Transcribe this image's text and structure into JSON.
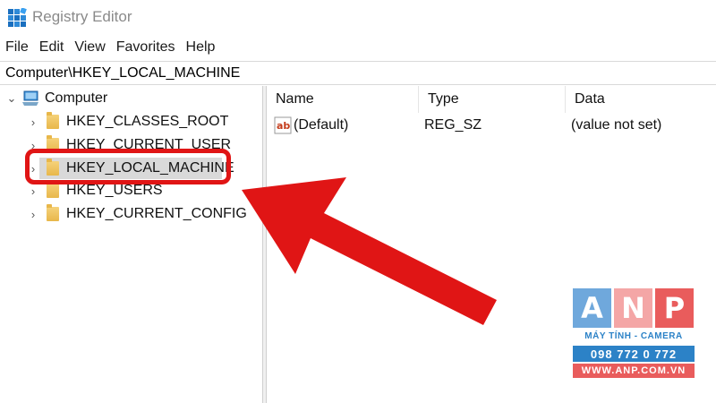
{
  "window": {
    "title": "Registry Editor",
    "icon": "registry-icon"
  },
  "menu": [
    "File",
    "Edit",
    "View",
    "Favorites",
    "Help"
  ],
  "address": "Computer\\HKEY_LOCAL_MACHINE",
  "tree": {
    "root": "Computer",
    "items": [
      "HKEY_CLASSES_ROOT",
      "HKEY_CURRENT_USER",
      "HKEY_LOCAL_MACHINE",
      "HKEY_USERS",
      "HKEY_CURRENT_CONFIG"
    ],
    "selected": "HKEY_LOCAL_MACHINE"
  },
  "list": {
    "columns": [
      "Name",
      "Type",
      "Data"
    ],
    "rows": [
      {
        "name": "(Default)",
        "type": "REG_SZ",
        "data": "(value not set)"
      }
    ]
  },
  "overlay": {
    "highlight_color": "#e01515",
    "logo": {
      "letters": [
        "A",
        "N",
        "P"
      ],
      "tagline": "MÁY TÍNH - CAMERA",
      "phone": "098 772 0 772",
      "website": "WWW.ANP.COM.VN"
    }
  },
  "colors": {
    "selection": "#d9d9d9",
    "folder": "#e8b74a",
    "logo_blue": "#2c82c7",
    "logo_pink": "#e95c5c"
  }
}
